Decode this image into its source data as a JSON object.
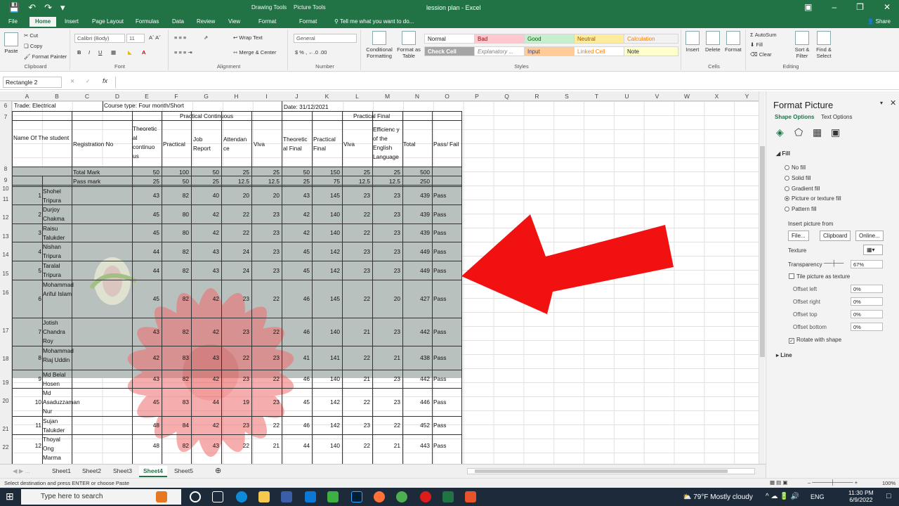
{
  "app": {
    "title": "lession plan  -  Excel",
    "ctx_drawing": "Drawing Tools",
    "ctx_picture": "Picture Tools",
    "share": "Share"
  },
  "tabs": [
    "File",
    "Home",
    "Insert",
    "Page Layout",
    "Formulas",
    "Data",
    "Review",
    "View",
    "Format",
    "Format"
  ],
  "tell_me": "Tell me what you want to do...",
  "ribbon": {
    "clipboard": {
      "paste": "Paste",
      "cut": "Cut",
      "copy": "Copy",
      "format_painter": "Format Painter",
      "label": "Clipboard"
    },
    "font": {
      "name": "Calibri (Body)",
      "size": "11",
      "label": "Font"
    },
    "alignment": {
      "wrap": "Wrap Text",
      "merge": "Merge & Center",
      "label": "Alignment"
    },
    "number": {
      "format": "General",
      "label": "Number"
    },
    "styles": {
      "cond": "Conditional Formatting",
      "table": "Format as Table",
      "cells": [
        "Normal",
        "Bad",
        "Good",
        "Neutral",
        "Calculation",
        "Check Cell",
        "Explanatory ...",
        "Input",
        "Linked Cell",
        "Note"
      ],
      "label": "Styles"
    },
    "cells": {
      "insert": "Insert",
      "delete": "Delete",
      "format": "Format",
      "label": "Cells"
    },
    "editing": {
      "autosum": "AutoSum",
      "fill": "Fill",
      "clear": "Clear",
      "sort": "Sort & Filter",
      "find": "Find & Select",
      "label": "Editing"
    }
  },
  "formula_bar": {
    "name_box": "Rectangle 2",
    "fx": "fx",
    "value": ""
  },
  "columns": [
    "A",
    "B",
    "C",
    "D",
    "E",
    "F",
    "G",
    "H",
    "I",
    "J",
    "K",
    "L",
    "M",
    "N",
    "O",
    "P",
    "Q",
    "R",
    "S",
    "T",
    "U",
    "V",
    "W",
    "X",
    "Y"
  ],
  "sheet": {
    "row6_left": "Trade: Electrical",
    "row6_mid": "Course type: Four month/Short",
    "row6_date": "Date: 31/12/2021",
    "group_continuous": "Practical Continuous",
    "group_final": "Practical Final",
    "headers": {
      "name": "Name Of The student",
      "reg": "Registration No",
      "theoretical": "Theoretic al continuo us",
      "practical": "Practical",
      "job": "Job Report",
      "attendance": "Attendan ce",
      "viva": "Viva",
      "theo_final": "Theoretic al Final",
      "prac_final": "Practical Final",
      "viva2": "Viva",
      "english": "Efficienc y of the English Language",
      "total": "Total",
      "passfail": "Pass/ Fail"
    },
    "total_mark": {
      "label": "Total Mark",
      "values": [
        "50",
        "100",
        "50",
        "25",
        "25",
        "50",
        "150",
        "25",
        "25",
        "500"
      ]
    },
    "pass_mark": {
      "label": "Pass mark",
      "values": [
        "25",
        "50",
        "25",
        "12.5",
        "12.5",
        "25",
        "75",
        "12.5",
        "12.5",
        "250"
      ]
    },
    "students": [
      {
        "sl": "1",
        "name": "Shohel Tripura",
        "v": [
          "43",
          "82",
          "40",
          "20",
          "20",
          "43",
          "145",
          "23",
          "23",
          "439"
        ],
        "res": "Pass"
      },
      {
        "sl": "2",
        "name": "Durjoy Chakma",
        "v": [
          "45",
          "80",
          "42",
          "22",
          "23",
          "42",
          "140",
          "22",
          "23",
          "439"
        ],
        "res": "Pass"
      },
      {
        "sl": "3",
        "name": "Raisu Talukder",
        "v": [
          "45",
          "80",
          "42",
          "22",
          "23",
          "42",
          "140",
          "22",
          "23",
          "439"
        ],
        "res": "Pass"
      },
      {
        "sl": "4",
        "name": "Nishan Tripura",
        "v": [
          "44",
          "82",
          "43",
          "24",
          "23",
          "45",
          "142",
          "23",
          "23",
          "449"
        ],
        "res": "Pass"
      },
      {
        "sl": "5",
        "name": "Taralal Tripura",
        "v": [
          "44",
          "82",
          "43",
          "24",
          "23",
          "45",
          "142",
          "23",
          "23",
          "449"
        ],
        "res": "Pass"
      },
      {
        "sl": "6",
        "name": "Mohammad Ariful Islam",
        "v": [
          "45",
          "82",
          "42",
          "23",
          "22",
          "46",
          "145",
          "22",
          "20",
          "427"
        ],
        "res": "Pass"
      },
      {
        "sl": "7",
        "name": "Jotish Chandra Roy",
        "v": [
          "43",
          "82",
          "42",
          "23",
          "22",
          "46",
          "140",
          "21",
          "23",
          "442"
        ],
        "res": "Pass"
      },
      {
        "sl": "8",
        "name": "Mohammad Riaj Uddin",
        "v": [
          "42",
          "83",
          "43",
          "22",
          "23",
          "41",
          "141",
          "22",
          "21",
          "438"
        ],
        "res": "Pass"
      },
      {
        "sl": "9",
        "name": "Md Belal Hosen",
        "v": [
          "43",
          "82",
          "42",
          "23",
          "22",
          "46",
          "140",
          "21",
          "23",
          "442"
        ],
        "res": "Pass"
      },
      {
        "sl": "10",
        "name": "Md Asaduzzaman Nur",
        "v": [
          "45",
          "83",
          "44",
          "19",
          "23",
          "45",
          "142",
          "22",
          "23",
          "446"
        ],
        "res": "Pass"
      },
      {
        "sl": "11",
        "name": "Sujan Talukder",
        "v": [
          "48",
          "84",
          "42",
          "23",
          "22",
          "46",
          "142",
          "23",
          "22",
          "452"
        ],
        "res": "Pass"
      },
      {
        "sl": "12",
        "name": "Thoyal Ong Marma",
        "v": [
          "48",
          "82",
          "43",
          "22",
          "21",
          "44",
          "140",
          "22",
          "21",
          "443"
        ],
        "res": "Pass"
      }
    ]
  },
  "sheets": [
    "Sheet1",
    "Sheet2",
    "Sheet3",
    "Sheet4",
    "Sheet5"
  ],
  "active_sheet": "Sheet4",
  "status": {
    "msg": "Select destination and press ENTER or choose Paste",
    "zoom": "100%"
  },
  "pane": {
    "title": "Format Picture",
    "tab1": "Shape Options",
    "tab2": "Text Options",
    "fill": "Fill",
    "options": [
      "No fill",
      "Solid fill",
      "Gradient fill",
      "Picture or texture fill",
      "Pattern fill"
    ],
    "insert_from": "Insert picture from",
    "file": "File...",
    "clipboard": "Clipboard",
    "online": "Online...",
    "texture": "Texture",
    "transparency": "Transparency",
    "transparency_val": "67%",
    "tile": "Tile picture as texture",
    "offsets": [
      {
        "k": "Offset left",
        "v": "0%"
      },
      {
        "k": "Offset right",
        "v": "0%"
      },
      {
        "k": "Offset top",
        "v": "0%"
      },
      {
        "k": "Offset bottom",
        "v": "0%"
      }
    ],
    "rotate": "Rotate with shape",
    "line": "Line"
  },
  "taskbar": {
    "search": "Type here to search",
    "weather": "79°F  Mostly cloudy",
    "lang": "ENG",
    "time": "11:30 PM",
    "date": "6/9/2022"
  }
}
